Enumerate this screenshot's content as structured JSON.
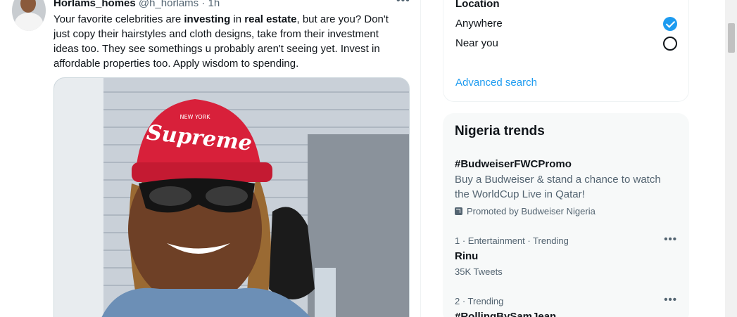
{
  "tweet": {
    "author_name": "Horlams_homes",
    "handle": "@h_horlams",
    "separator": "·",
    "time": "1h",
    "more": "•••",
    "text_parts": [
      {
        "text": "Your favorite celebrities are ",
        "bold": false
      },
      {
        "text": "investing",
        "bold": true
      },
      {
        "text": " in ",
        "bold": false
      },
      {
        "text": "real estate",
        "bold": true
      },
      {
        "text": ", but are you? Don't just copy their hairstyles and cloth designs, take from their investment ideas too. They see somethings u probably aren't seeing yet. Invest in affordable properties too. Apply wisdom to spending.",
        "bold": false
      }
    ],
    "media_cap_text": "Supreme",
    "media_cap_small": "NEW YORK"
  },
  "search_filters": {
    "location_title": "Location",
    "options": [
      {
        "label": "Anywhere",
        "checked": true
      },
      {
        "label": "Near you",
        "checked": false
      }
    ],
    "advanced_search": "Advanced search"
  },
  "trends": {
    "title": "Nigeria trends",
    "promoted": {
      "tag": "#BudweiserFWCPromo",
      "description": "Buy a Budweiser & stand a chance to watch the WorldCup Live in Qatar!",
      "promoted_by": "Promoted by Budweiser Nigeria"
    },
    "items": [
      {
        "meta": "1 · Entertainment · Trending",
        "name": "Rinu",
        "count": "35K Tweets"
      },
      {
        "meta": "2 · Trending",
        "name": "#RollingBySamJean",
        "count": ""
      }
    ],
    "more": "•••"
  },
  "colors": {
    "accent": "#1d9bf0",
    "text": "#0f1419",
    "secondary": "#536471",
    "trends_bg": "#f7f9f9"
  }
}
